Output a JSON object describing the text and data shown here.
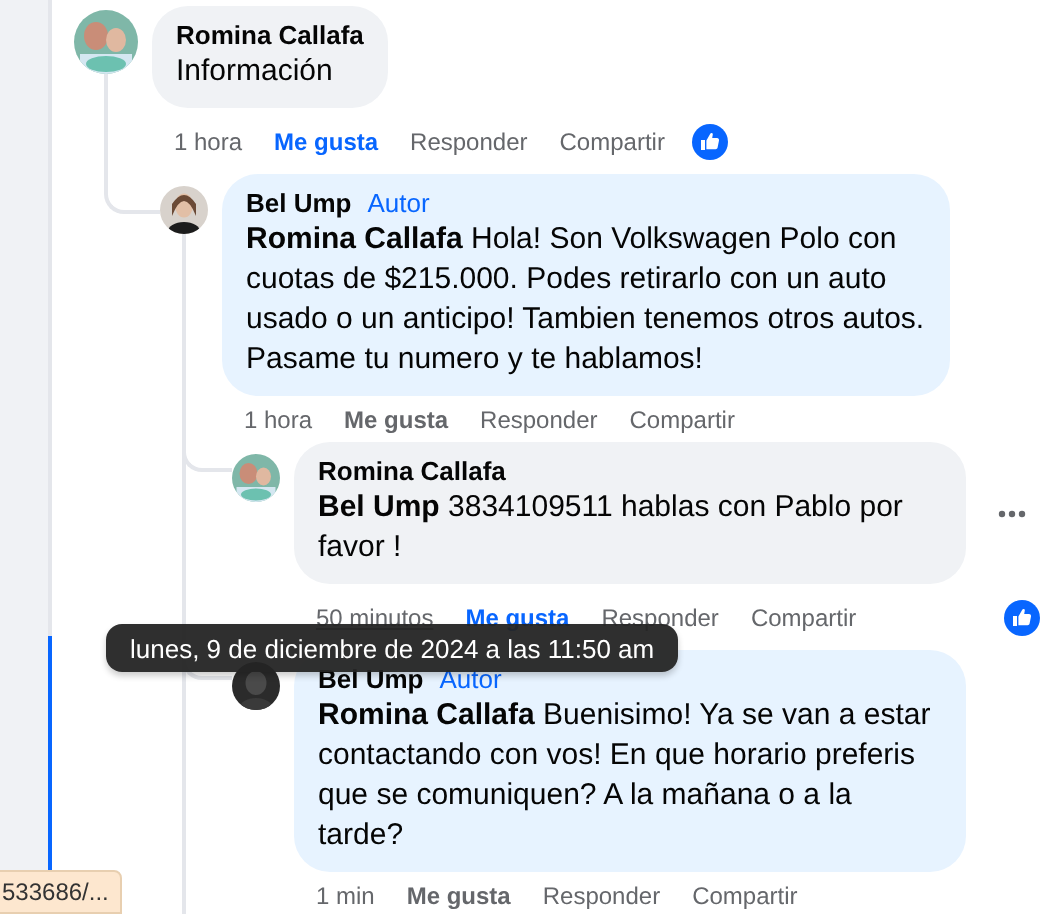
{
  "comments": [
    {
      "author": "Romina Callafa",
      "text": "Información",
      "time": "1 hora",
      "time_hovered": false,
      "like_label": "Me gusta",
      "liked": true,
      "reply_label": "Responder",
      "share_label": "Compartir",
      "reaction": true,
      "menu_visible": false,
      "children": [
        {
          "author": "Bel Ump",
          "badge": "Autor",
          "text": "**Romina Callafa** Hola! Son Volkswagen Polo con cuotas de $215.000. Podes retirarlo con un auto usado o un anticipo! Tambien tenemos otros autos. Pasame tu numero y te hablamos!",
          "time": "1 hora",
          "time_hovered": false,
          "like_label": "Me gusta",
          "liked": false,
          "reply_label": "Responder",
          "share_label": "Compartir",
          "reaction": false,
          "menu_visible": false,
          "children": [
            {
              "author": "Romina Callafa",
              "text": "**Bel Ump** 3834109511 hablas con Pablo por favor !",
              "time": "50 minutos",
              "time_hovered": true,
              "like_label": "Me gusta",
              "liked": true,
              "reply_label": "Responder",
              "share_label": "Compartir",
              "reaction": true,
              "menu_visible": true
            },
            {
              "author": "Bel Ump",
              "badge": "Autor",
              "text": "**Romina Callafa** Buenisimo! Ya se van a estar contactando con vos! En que horario preferis que se comuniquen? A la mañana o a la tarde?",
              "time": "1 min",
              "time_hovered": false,
              "like_label": "Me gusta",
              "liked": false,
              "reply_label": "Responder",
              "share_label": "Compartir",
              "reaction": false,
              "menu_visible": false
            }
          ]
        }
      ]
    }
  ],
  "tooltip": "lunes, 9 de diciembre de 2024 a las 11:50 am",
  "status_url": "533686/..."
}
